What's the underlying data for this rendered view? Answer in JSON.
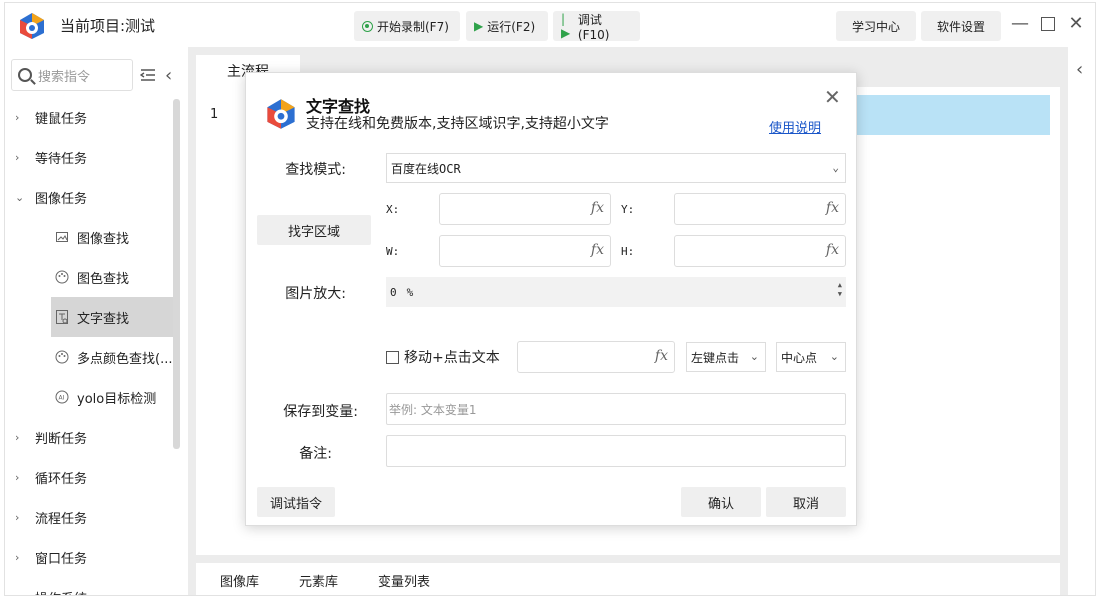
{
  "titlebar": {
    "project_title": "当前项目:测试",
    "record_label": "开始录制(F7)",
    "run_label": "运行(F2)",
    "debug_label": "调试(F10)",
    "learn_label": "学习中心",
    "settings_label": "软件设置"
  },
  "sidebar": {
    "search_placeholder": "搜索指令",
    "items": [
      {
        "label": "键鼠任务",
        "expanded": false
      },
      {
        "label": "等待任务",
        "expanded": false
      },
      {
        "label": "图像任务",
        "expanded": true
      },
      {
        "label": "判断任务",
        "expanded": false
      },
      {
        "label": "循环任务",
        "expanded": false
      },
      {
        "label": "流程任务",
        "expanded": false
      },
      {
        "label": "窗口任务",
        "expanded": false
      },
      {
        "label": "操作系统",
        "expanded": false
      }
    ],
    "sub_items": [
      {
        "label": "图像查找",
        "icon": "image-icon"
      },
      {
        "label": "图色查找",
        "icon": "palette-icon"
      },
      {
        "label": "文字查找",
        "icon": "text-search-icon",
        "active": true
      },
      {
        "label": "多点颜色查找(...",
        "icon": "palette-icon"
      },
      {
        "label": "yolo目标检测",
        "icon": "ai-icon"
      }
    ]
  },
  "main": {
    "tab_label": "主流程",
    "line_number": "1",
    "bottom_tabs": [
      "图像库",
      "元素库",
      "变量列表"
    ]
  },
  "dialog": {
    "title": "文字查找",
    "subtitle": "支持在线和免费版本,支持区域识字,支持超小文字",
    "help_link": "使用说明",
    "mode_label": "查找模式:",
    "mode_value": "百度在线OCR",
    "region_button": "找字区域",
    "x_label": "X:",
    "y_label": "Y:",
    "w_label": "W:",
    "h_label": "H:",
    "zoom_label": "图片放大:",
    "zoom_value": "0",
    "zoom_unit": "%",
    "move_click_label": "移动+点击文本",
    "click_type": "左键点击",
    "click_pos": "中心点",
    "save_label": "保存到变量:",
    "save_placeholder": "举例: 文本变量1",
    "note_label": "备注:",
    "debug_button": "调试指令",
    "ok_button": "确认",
    "cancel_button": "取消",
    "fx": "fx"
  }
}
